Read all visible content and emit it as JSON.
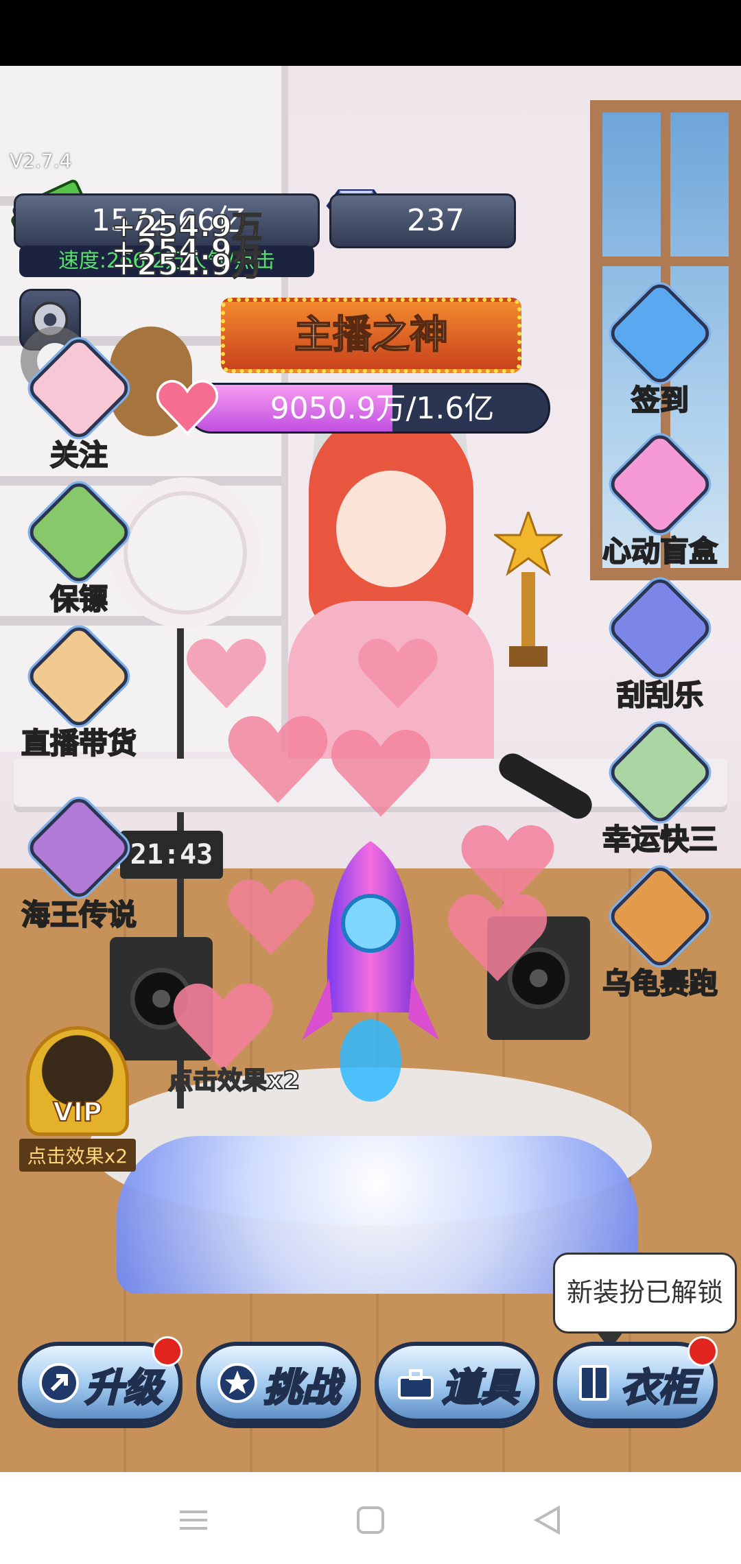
{
  "hud": {
    "version": "V2.7.4",
    "money": "1572.66亿",
    "gems": "237",
    "speed": "速度:266.2万人气/点击",
    "gains": [
      "+254.9万",
      "+254.9万",
      "+254.9万"
    ],
    "title": "主播之神",
    "popularity": "9050.9万/1.6亿",
    "popularity_fraction": 0.566
  },
  "left_features": [
    {
      "label": "关注",
      "icon": "heart-hand-icon"
    },
    {
      "label": "保镖",
      "icon": "frog-icon"
    },
    {
      "label": "直播带货",
      "icon": "gift-box-icon"
    },
    {
      "label": "海王传说",
      "icon": "couple-icon"
    }
  ],
  "right_features": [
    {
      "label": "签到",
      "icon": "clipboard-check-icon"
    },
    {
      "label": "心动盲盒",
      "icon": "mystery-box-icon"
    },
    {
      "label": "刮刮乐",
      "icon": "lottery-icon"
    },
    {
      "label": "幸运快三",
      "icon": "lottery-balls-icon"
    },
    {
      "label": "乌龟赛跑",
      "icon": "turtle-icon"
    }
  ],
  "vip": {
    "badge": "VIP",
    "label": "点击效果x2"
  },
  "scene": {
    "clock": "21:43",
    "overlay_text": "点击效果x2"
  },
  "tooltip": "新装扮已解锁",
  "bottom_buttons": [
    {
      "label": "升级",
      "icon": "upgrade-arrow-icon",
      "badge": true
    },
    {
      "label": "挑战",
      "icon": "star-badge-icon",
      "badge": false
    },
    {
      "label": "道具",
      "icon": "toolbox-icon",
      "badge": false
    },
    {
      "label": "衣柜",
      "icon": "wardrobe-icon",
      "badge": true
    }
  ],
  "colors": {
    "speed_text": "#58e06a",
    "banner": "#f38a2e",
    "progress_fill": "#d36ae8",
    "badge": "#e0251f"
  }
}
